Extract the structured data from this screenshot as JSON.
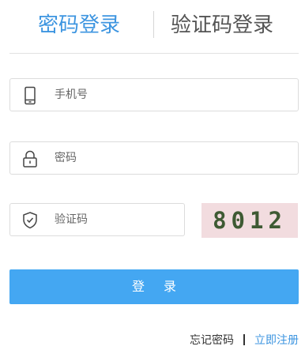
{
  "tabs": {
    "password_login": "密码登录",
    "code_login": "验证码登录"
  },
  "fields": {
    "phone_placeholder": "手机号",
    "password_placeholder": "密码",
    "code_placeholder": "验证码"
  },
  "icons": {
    "phone": "phone-icon",
    "lock": "lock-icon",
    "shield": "shield-check-icon"
  },
  "captcha": {
    "text": "8012",
    "background": "#f2dcdf",
    "text_color": "#3e5a33"
  },
  "login_button": "登录",
  "footer": {
    "forgot": "忘记密码",
    "register": "立即注册"
  },
  "colors": {
    "accent": "#3d95e0",
    "button": "#44a7f2"
  }
}
